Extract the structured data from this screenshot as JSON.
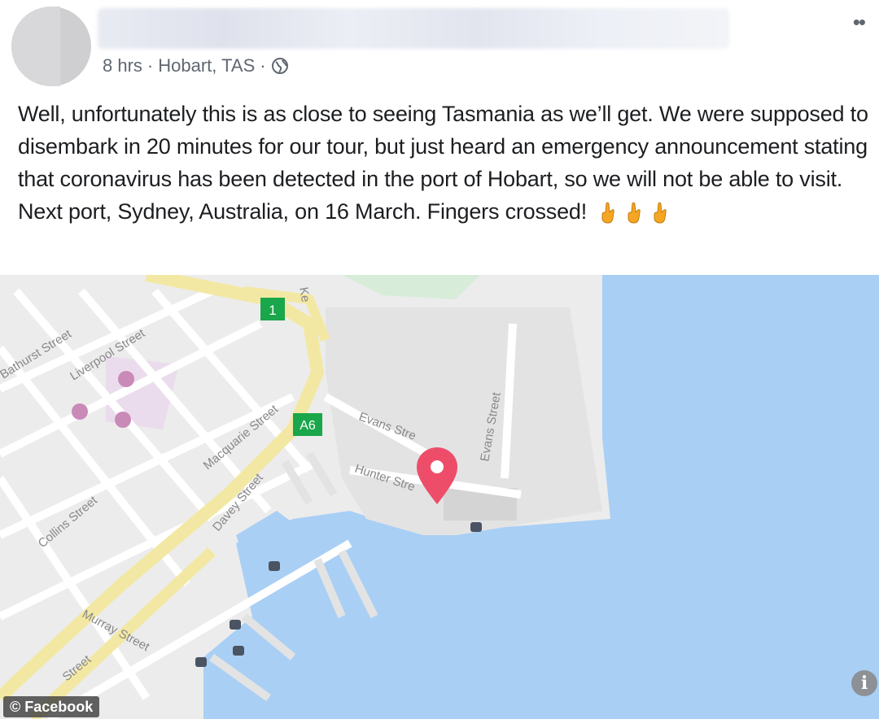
{
  "post": {
    "timestamp": "8 hrs",
    "separator": "·",
    "location": "Hobart, TAS",
    "privacy_icon": "globe-icon",
    "more_icon": "more-options-icon",
    "body_text": "Well, unfortunately this is as close to seeing Tasmania as we’ll get. We were supposed to disembark in 20 minutes for our tour, but just heard an emergency announcement stating that coronavirus has been detected in the port of Hobart, so we will not be able to visit. Next port, Sydney, Australia, on 16 March. Fingers crossed!",
    "emoji": [
      "crossed-fingers-icon",
      "crossed-fingers-icon",
      "crossed-fingers-icon"
    ]
  },
  "map": {
    "route_badges": [
      "1",
      "A6"
    ],
    "street_labels": {
      "bathurst": "Bathurst Street",
      "liverpool": "Liverpool Street",
      "macquarie": "Macquarie Street",
      "davey": "Davey Street",
      "collins": "Collins Street",
      "murray": "Murray Street",
      "evans1": "Evans Stre",
      "evans2": "Evans Street",
      "hunter": "Hunter Stre",
      "street_bottom": "Street",
      "ke": "Ke"
    },
    "colors": {
      "water": "#a9cff5",
      "land": "#ececec",
      "road_major": "#f3e8a3",
      "pin": "#ee4d6a",
      "badge": "#1aa64a"
    }
  },
  "credit": "© Facebook",
  "info_icon": "info-icon"
}
